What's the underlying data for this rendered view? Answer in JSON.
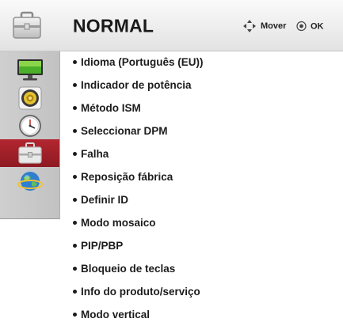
{
  "header": {
    "title": "NORMAL",
    "icon": "toolbox-icon",
    "hints": {
      "move_label": "Mover",
      "move_icon": "four-way-arrows-icon",
      "ok_label": "OK",
      "ok_icon": "ok-circle-icon"
    }
  },
  "sidebar": {
    "items": [
      {
        "icon": "monitor-icon",
        "active": false
      },
      {
        "icon": "speaker-icon",
        "active": false
      },
      {
        "icon": "clock-icon",
        "active": false
      },
      {
        "icon": "toolbox-icon",
        "active": true
      },
      {
        "icon": "globe-icon",
        "active": false
      }
    ],
    "active_color": "#a0202a"
  },
  "menu": {
    "items": [
      "Idioma (Português (EU))",
      "Indicador de potência",
      "Método ISM",
      "Seleccionar DPM",
      "Falha",
      "Reposição fábrica",
      "Definir ID",
      "Modo mosaico",
      "PIP/PBP",
      "Bloqueio de teclas",
      "Info do produto/serviço",
      "Modo vertical"
    ]
  }
}
